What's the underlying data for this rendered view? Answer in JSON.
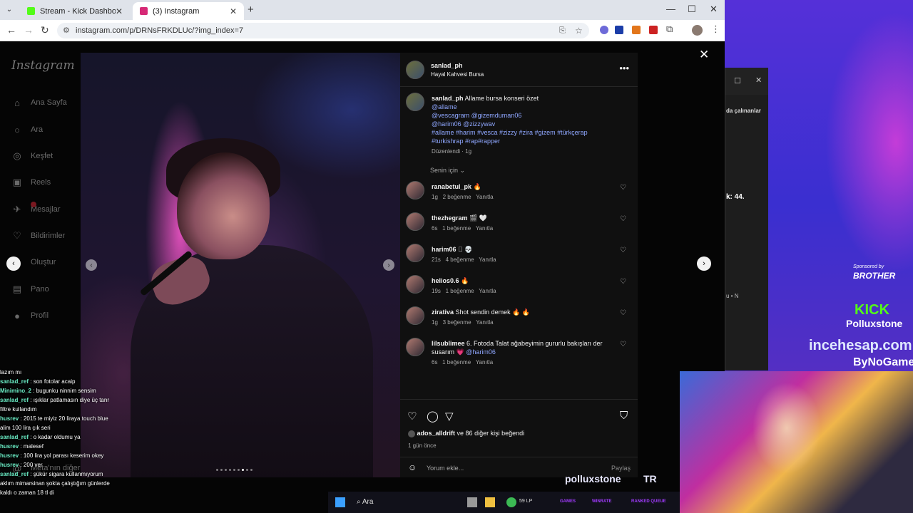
{
  "browser": {
    "tabs": [
      {
        "title": "Stream - Kick Dashboard",
        "favicon_color": "#53fc18"
      },
      {
        "title": "(3) Instagram",
        "favicon_color": "#d62976"
      }
    ],
    "url": "instagram.com/p/DRNsFRKDLUc/?img_index=7"
  },
  "sidebar": {
    "logo": "Instagram",
    "items": [
      {
        "label": "Ana Sayfa",
        "icon": "home-icon"
      },
      {
        "label": "Ara",
        "icon": "search-icon"
      },
      {
        "label": "Keşfet",
        "icon": "compass-icon"
      },
      {
        "label": "Reels",
        "icon": "reels-icon"
      },
      {
        "label": "Mesajlar",
        "icon": "messenger-icon"
      },
      {
        "label": "Bildirimler",
        "icon": "heart-icon"
      },
      {
        "label": "Oluştur",
        "icon": "plus-icon"
      },
      {
        "label": "Pano",
        "icon": "dashboard-icon"
      },
      {
        "label": "Profil",
        "icon": "profile-icon"
      }
    ],
    "more": "Meta'nın diğer"
  },
  "post": {
    "author": "sanlad_ph",
    "location": "Hayal Kahvesi Bursa",
    "caption_text": "Allame bursa konseri özet",
    "mentions_line1": "@allame",
    "mentions_line2": "@vescagram @gizemduman06",
    "mentions_line3": "@harim06 @zizzywav",
    "hashtags_line1": "#allame #harim #vesca #zizzy #zira #gizem #türkçerap",
    "hashtags_line2": "#turkishrap #rap#rapper",
    "edited": "Düzenlendi · 1g",
    "filter": "Senin için",
    "likes_user": "ados_alldrift",
    "likes_rest": "ve 86 diğer kişi",
    "likes_suffix": "beğendi",
    "time_ago": "1 gün önce",
    "comment_placeholder": "Yorum ekle...",
    "share_label": "Paylaş",
    "image_index": 7,
    "image_count": 9
  },
  "comments": [
    {
      "user": "ranabetul_pk",
      "text": "🔥",
      "time": "1g",
      "likes": "2 beğenme",
      "reply": "Yanıtla"
    },
    {
      "user": "thezhegram",
      "text": "🎬 🤍",
      "time": "6s",
      "likes": "1 beğenme",
      "reply": "Yanıtla"
    },
    {
      "user": "harim06",
      "text": "🏻 💀",
      "time": "21s",
      "likes": "4 beğenme",
      "reply": "Yanıtla"
    },
    {
      "user": "helios0.6",
      "text": "🔥",
      "time": "19s",
      "likes": "1 beğenme",
      "reply": "Yanıtla"
    },
    {
      "user": "zirativa",
      "text": "Shot sendin demek 🔥 🔥",
      "time": "1g",
      "likes": "3 beğenme",
      "reply": "Yanıtla"
    },
    {
      "user": "lilsublimee",
      "text": "6. Fotoda Talat ağabeyimin gururlu bakışları der susarım 💗",
      "mention": "@harim06",
      "time": "6s",
      "likes": "1 beğenme",
      "reply": "Yanıtla"
    }
  ],
  "chat": [
    {
      "user": "",
      "text": "lazım mı"
    },
    {
      "user": "sanlad_ref",
      "text": ": son fotolar acaip"
    },
    {
      "user": "Minimino_2",
      "text": ": bugunku ninnim sensim"
    },
    {
      "user": "sanlad_ref",
      "text": ": ışıklar patlamasın diye üç tanr filtre kullandım"
    },
    {
      "user": "husrev",
      "text": ": 2015 te miyiz 20 liraya touch blue alim 100 lira çık seri"
    },
    {
      "user": "sanlad_ref",
      "text": ": o kadar oldumu ya"
    },
    {
      "user": "husrev",
      "text": ": malesef"
    },
    {
      "user": "husrev",
      "text": ": 100 lira yol parası keserim okey"
    },
    {
      "user": "husrev",
      "text": ": 200 ver"
    },
    {
      "user": "sanlad_ref",
      "text": ": şükür sigara kullanmıyorum aklım mimarsinan şokta çalıştığım günlerde kaldı o zaman 18 tl di"
    }
  ],
  "overlay": {
    "sponsored_by": "Sponsored by",
    "brother": "BROTHER",
    "kick": "KICK",
    "kick_user": "Polluxstone",
    "incehesap": "incehesap.com",
    "bynogame": "ByNoGame",
    "stream_name": "polluxstone",
    "country": "TR",
    "side_text1": "da çalınanlar",
    "side_text2": "k: 44.",
    "side_text3": "u • N"
  },
  "taskbar": {
    "search": "Ara",
    "lp": "59 LP",
    "games": "GAMES",
    "winrate": "WINRATE",
    "ranked": "RANKED QUEUE"
  }
}
